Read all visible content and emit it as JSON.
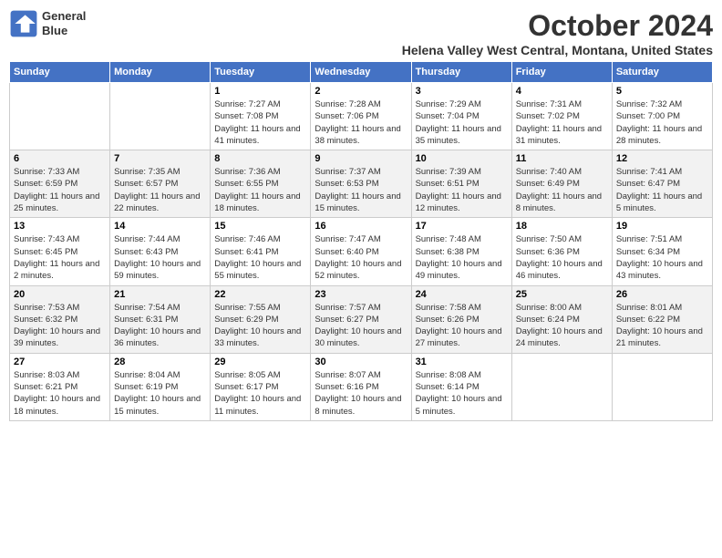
{
  "header": {
    "logo_line1": "General",
    "logo_line2": "Blue",
    "month": "October 2024",
    "location": "Helena Valley West Central, Montana, United States"
  },
  "days_of_week": [
    "Sunday",
    "Monday",
    "Tuesday",
    "Wednesday",
    "Thursday",
    "Friday",
    "Saturday"
  ],
  "weeks": [
    [
      {
        "day": "",
        "info": ""
      },
      {
        "day": "",
        "info": ""
      },
      {
        "day": "1",
        "info": "Sunrise: 7:27 AM\nSunset: 7:08 PM\nDaylight: 11 hours and 41 minutes."
      },
      {
        "day": "2",
        "info": "Sunrise: 7:28 AM\nSunset: 7:06 PM\nDaylight: 11 hours and 38 minutes."
      },
      {
        "day": "3",
        "info": "Sunrise: 7:29 AM\nSunset: 7:04 PM\nDaylight: 11 hours and 35 minutes."
      },
      {
        "day": "4",
        "info": "Sunrise: 7:31 AM\nSunset: 7:02 PM\nDaylight: 11 hours and 31 minutes."
      },
      {
        "day": "5",
        "info": "Sunrise: 7:32 AM\nSunset: 7:00 PM\nDaylight: 11 hours and 28 minutes."
      }
    ],
    [
      {
        "day": "6",
        "info": "Sunrise: 7:33 AM\nSunset: 6:59 PM\nDaylight: 11 hours and 25 minutes."
      },
      {
        "day": "7",
        "info": "Sunrise: 7:35 AM\nSunset: 6:57 PM\nDaylight: 11 hours and 22 minutes."
      },
      {
        "day": "8",
        "info": "Sunrise: 7:36 AM\nSunset: 6:55 PM\nDaylight: 11 hours and 18 minutes."
      },
      {
        "day": "9",
        "info": "Sunrise: 7:37 AM\nSunset: 6:53 PM\nDaylight: 11 hours and 15 minutes."
      },
      {
        "day": "10",
        "info": "Sunrise: 7:39 AM\nSunset: 6:51 PM\nDaylight: 11 hours and 12 minutes."
      },
      {
        "day": "11",
        "info": "Sunrise: 7:40 AM\nSunset: 6:49 PM\nDaylight: 11 hours and 8 minutes."
      },
      {
        "day": "12",
        "info": "Sunrise: 7:41 AM\nSunset: 6:47 PM\nDaylight: 11 hours and 5 minutes."
      }
    ],
    [
      {
        "day": "13",
        "info": "Sunrise: 7:43 AM\nSunset: 6:45 PM\nDaylight: 11 hours and 2 minutes."
      },
      {
        "day": "14",
        "info": "Sunrise: 7:44 AM\nSunset: 6:43 PM\nDaylight: 10 hours and 59 minutes."
      },
      {
        "day": "15",
        "info": "Sunrise: 7:46 AM\nSunset: 6:41 PM\nDaylight: 10 hours and 55 minutes."
      },
      {
        "day": "16",
        "info": "Sunrise: 7:47 AM\nSunset: 6:40 PM\nDaylight: 10 hours and 52 minutes."
      },
      {
        "day": "17",
        "info": "Sunrise: 7:48 AM\nSunset: 6:38 PM\nDaylight: 10 hours and 49 minutes."
      },
      {
        "day": "18",
        "info": "Sunrise: 7:50 AM\nSunset: 6:36 PM\nDaylight: 10 hours and 46 minutes."
      },
      {
        "day": "19",
        "info": "Sunrise: 7:51 AM\nSunset: 6:34 PM\nDaylight: 10 hours and 43 minutes."
      }
    ],
    [
      {
        "day": "20",
        "info": "Sunrise: 7:53 AM\nSunset: 6:32 PM\nDaylight: 10 hours and 39 minutes."
      },
      {
        "day": "21",
        "info": "Sunrise: 7:54 AM\nSunset: 6:31 PM\nDaylight: 10 hours and 36 minutes."
      },
      {
        "day": "22",
        "info": "Sunrise: 7:55 AM\nSunset: 6:29 PM\nDaylight: 10 hours and 33 minutes."
      },
      {
        "day": "23",
        "info": "Sunrise: 7:57 AM\nSunset: 6:27 PM\nDaylight: 10 hours and 30 minutes."
      },
      {
        "day": "24",
        "info": "Sunrise: 7:58 AM\nSunset: 6:26 PM\nDaylight: 10 hours and 27 minutes."
      },
      {
        "day": "25",
        "info": "Sunrise: 8:00 AM\nSunset: 6:24 PM\nDaylight: 10 hours and 24 minutes."
      },
      {
        "day": "26",
        "info": "Sunrise: 8:01 AM\nSunset: 6:22 PM\nDaylight: 10 hours and 21 minutes."
      }
    ],
    [
      {
        "day": "27",
        "info": "Sunrise: 8:03 AM\nSunset: 6:21 PM\nDaylight: 10 hours and 18 minutes."
      },
      {
        "day": "28",
        "info": "Sunrise: 8:04 AM\nSunset: 6:19 PM\nDaylight: 10 hours and 15 minutes."
      },
      {
        "day": "29",
        "info": "Sunrise: 8:05 AM\nSunset: 6:17 PM\nDaylight: 10 hours and 11 minutes."
      },
      {
        "day": "30",
        "info": "Sunrise: 8:07 AM\nSunset: 6:16 PM\nDaylight: 10 hours and 8 minutes."
      },
      {
        "day": "31",
        "info": "Sunrise: 8:08 AM\nSunset: 6:14 PM\nDaylight: 10 hours and 5 minutes."
      },
      {
        "day": "",
        "info": ""
      },
      {
        "day": "",
        "info": ""
      }
    ]
  ]
}
